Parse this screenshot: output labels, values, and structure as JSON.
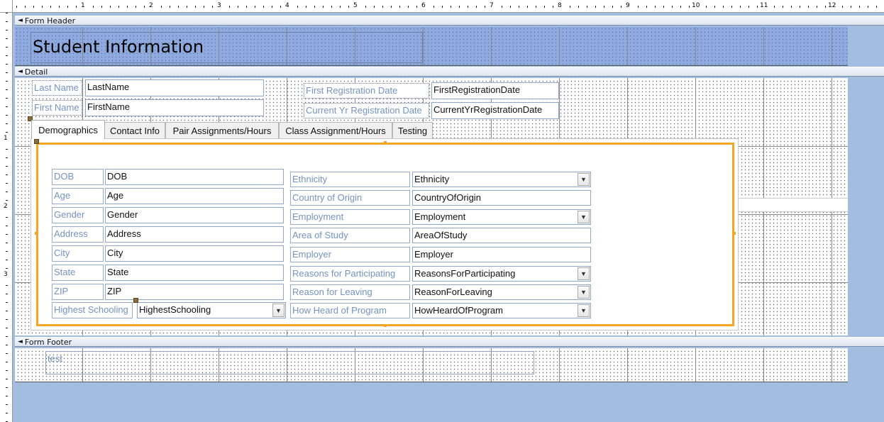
{
  "ruler": {
    "numbers": [
      "1",
      "2",
      "3",
      "4",
      "5",
      "6",
      "7",
      "8",
      "9",
      "10",
      "11",
      "12"
    ],
    "left_numbers": [
      "1",
      "2",
      "3"
    ]
  },
  "sections": {
    "header": "Form Header",
    "detail": "Detail",
    "footer": "Form Footer"
  },
  "header": {
    "title": "Student Information"
  },
  "top_fields": {
    "last_name": {
      "label": "Last Name",
      "value": "LastName"
    },
    "first_name": {
      "label": "First Name",
      "value": "FirstName"
    },
    "first_reg": {
      "label": "First Registration Date",
      "value": "FirstRegistrationDate"
    },
    "current_reg": {
      "label": "Current Yr Registration Date",
      "value": "CurrentYrRegistrationDate"
    }
  },
  "tabs": [
    {
      "label": "Demographics"
    },
    {
      "label": "Contact Info"
    },
    {
      "label": "Pair Assignments/Hours"
    },
    {
      "label": "Class Assignment/Hours"
    },
    {
      "label": "Testing"
    }
  ],
  "left_fields": [
    {
      "label": "DOB",
      "value": "DOB"
    },
    {
      "label": "Age",
      "value": "Age"
    },
    {
      "label": "Gender",
      "value": "Gender"
    },
    {
      "label": "Address",
      "value": "Address"
    },
    {
      "label": "City",
      "value": "City"
    },
    {
      "label": "State",
      "value": "State"
    },
    {
      "label": "ZIP",
      "value": "ZIP"
    }
  ],
  "highest_schooling": {
    "label": "Highest Schooling",
    "value": "HighestSchooling"
  },
  "right_fields": [
    {
      "label": "Ethnicity",
      "value": "Ethnicity",
      "combo": true
    },
    {
      "label": "Country of Origin",
      "value": "CountryOfOrigin",
      "combo": false
    },
    {
      "label": "Employment",
      "value": "Employment",
      "combo": true
    },
    {
      "label": "Area of Study",
      "value": "AreaOfStudy",
      "combo": false
    },
    {
      "label": "Employer",
      "value": "Employer",
      "combo": false
    },
    {
      "label": "Reasons for Participating",
      "value": "ReasonsForParticipating",
      "combo": true
    },
    {
      "label": "Reason for Leaving",
      "value": "ReasonForLeaving",
      "combo": true
    },
    {
      "label": "How Heard of Program",
      "value": "HowHeardOfProgram",
      "combo": true
    }
  ],
  "footer": {
    "test_label": "test"
  },
  "colors": {
    "canvas": "#a3bde0",
    "header_fill": "#8eaadf",
    "selection": "#f5a623",
    "label_text": "#7593c4"
  },
  "icons": {
    "section_toggle": "chevron-up-double-icon",
    "combo": "chevron-down-icon"
  }
}
